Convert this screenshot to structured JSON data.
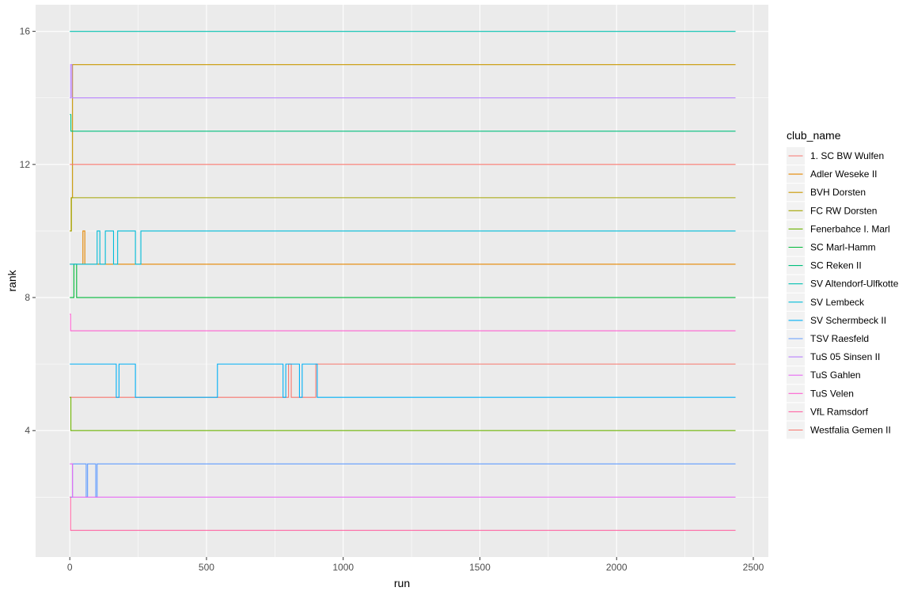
{
  "chart_data": {
    "type": "line",
    "title": "",
    "xlabel": "run",
    "ylabel": "rank",
    "xlim": [
      -125,
      2555
    ],
    "ylim": [
      0.2,
      16.8
    ],
    "x_ticks": [
      0,
      500,
      1000,
      1500,
      2000,
      2500
    ],
    "y_ticks": [
      4,
      8,
      12,
      16
    ],
    "grid": true,
    "background": "#ebebeb",
    "legend": {
      "title": "club_name",
      "position": "right"
    },
    "x_max_run": 2435,
    "series": [
      {
        "name": "1. SC BW Wulfen",
        "color": "#F8766D",
        "segments": [
          [
            0,
            5
          ],
          [
            800,
            6
          ],
          [
            810,
            5
          ],
          [
            900,
            6
          ]
        ],
        "end": 6
      },
      {
        "name": "Adler Weseke II",
        "color": "#E58700",
        "segments": [
          [
            0,
            9
          ],
          [
            48,
            10
          ],
          [
            55,
            9
          ]
        ],
        "end": 9
      },
      {
        "name": "BVH Dorsten",
        "color": "#C99800",
        "segments": [
          [
            0,
            10
          ],
          [
            5,
            11
          ],
          [
            10,
            15
          ]
        ],
        "end": 15
      },
      {
        "name": "FC RW Dorsten",
        "color": "#A3A500",
        "segments": [
          [
            0,
            10
          ],
          [
            6,
            11
          ]
        ],
        "end": 11
      },
      {
        "name": "Fenerbahce I. Marl",
        "color": "#6BB100",
        "segments": [
          [
            0,
            5
          ],
          [
            4,
            4
          ]
        ],
        "end": 4
      },
      {
        "name": "SC Marl-Hamm",
        "color": "#00BA38",
        "segments": [
          [
            0,
            8
          ],
          [
            15,
            9
          ],
          [
            25,
            8
          ]
        ],
        "end": 8
      },
      {
        "name": "SC Reken II",
        "color": "#00BF7D",
        "segments": [
          [
            0,
            13.5
          ],
          [
            4,
            13
          ]
        ],
        "end": 13
      },
      {
        "name": "SV Altendorf-Ulfkotte",
        "color": "#00C0AF",
        "segments": [
          [
            0,
            16
          ]
        ],
        "end": 16
      },
      {
        "name": "SV Lembeck",
        "color": "#00BCD8",
        "segments": [
          [
            0,
            9
          ],
          [
            100,
            10
          ],
          [
            110,
            9
          ],
          [
            130,
            10
          ],
          [
            160,
            9
          ],
          [
            175,
            10
          ],
          [
            240,
            9
          ],
          [
            260,
            10
          ]
        ],
        "end": 10
      },
      {
        "name": "SV Schermbeck II",
        "color": "#00B0F6",
        "segments": [
          [
            0,
            6
          ],
          [
            170,
            5
          ],
          [
            180,
            6
          ],
          [
            240,
            5
          ],
          [
            540,
            6
          ],
          [
            780,
            5
          ],
          [
            790,
            6
          ],
          [
            840,
            5
          ],
          [
            850,
            6
          ],
          [
            905,
            5
          ]
        ],
        "end": 5
      },
      {
        "name": "TSV Raesfeld",
        "color": "#619CFF",
        "segments": [
          [
            0,
            2
          ],
          [
            10,
            3
          ],
          [
            60,
            2
          ],
          [
            65,
            3
          ],
          [
            95,
            2
          ],
          [
            100,
            3
          ]
        ],
        "end": 3
      },
      {
        "name": "TuS 05 Sinsen II",
        "color": "#B983FF",
        "segments": [
          [
            0,
            14
          ],
          [
            3,
            15
          ],
          [
            8,
            14
          ]
        ],
        "end": 14
      },
      {
        "name": "TuS Gahlen",
        "color": "#E76BF3",
        "segments": [
          [
            0,
            3
          ],
          [
            10,
            2
          ]
        ],
        "end": 2
      },
      {
        "name": "TuS Velen",
        "color": "#FD61D1",
        "segments": [
          [
            0,
            7.5
          ],
          [
            3,
            7
          ]
        ],
        "end": 7
      },
      {
        "name": "VfL Ramsdorf",
        "color": "#FF67A4",
        "segments": [
          [
            0,
            2
          ],
          [
            3,
            1
          ]
        ],
        "end": 1
      },
      {
        "name": "Westfalia Gemen II",
        "color": "#F8766D",
        "segments": [
          [
            0,
            12
          ]
        ],
        "end": 12
      }
    ]
  }
}
